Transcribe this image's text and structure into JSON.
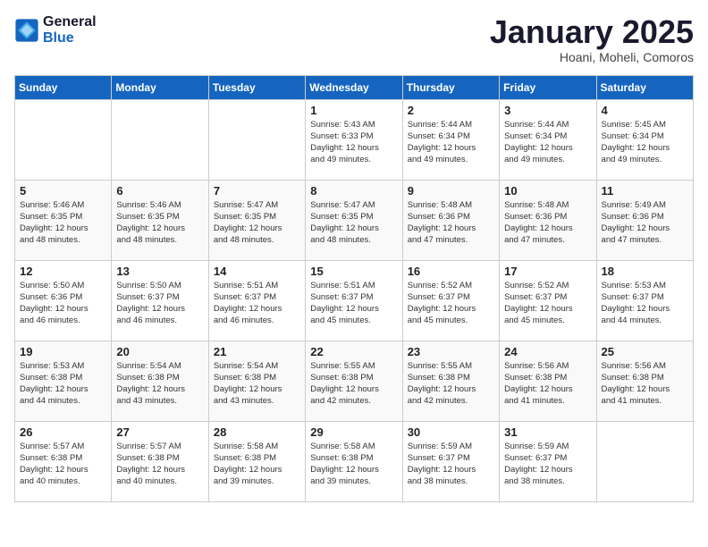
{
  "logo": {
    "line1": "General",
    "line2": "Blue"
  },
  "title": "January 2025",
  "subtitle": "Hoani, Moheli, Comoros",
  "weekdays": [
    "Sunday",
    "Monday",
    "Tuesday",
    "Wednesday",
    "Thursday",
    "Friday",
    "Saturday"
  ],
  "weeks": [
    [
      {
        "day": "",
        "info": ""
      },
      {
        "day": "",
        "info": ""
      },
      {
        "day": "",
        "info": ""
      },
      {
        "day": "1",
        "info": "Sunrise: 5:43 AM\nSunset: 6:33 PM\nDaylight: 12 hours\nand 49 minutes."
      },
      {
        "day": "2",
        "info": "Sunrise: 5:44 AM\nSunset: 6:34 PM\nDaylight: 12 hours\nand 49 minutes."
      },
      {
        "day": "3",
        "info": "Sunrise: 5:44 AM\nSunset: 6:34 PM\nDaylight: 12 hours\nand 49 minutes."
      },
      {
        "day": "4",
        "info": "Sunrise: 5:45 AM\nSunset: 6:34 PM\nDaylight: 12 hours\nand 49 minutes."
      }
    ],
    [
      {
        "day": "5",
        "info": "Sunrise: 5:46 AM\nSunset: 6:35 PM\nDaylight: 12 hours\nand 48 minutes."
      },
      {
        "day": "6",
        "info": "Sunrise: 5:46 AM\nSunset: 6:35 PM\nDaylight: 12 hours\nand 48 minutes."
      },
      {
        "day": "7",
        "info": "Sunrise: 5:47 AM\nSunset: 6:35 PM\nDaylight: 12 hours\nand 48 minutes."
      },
      {
        "day": "8",
        "info": "Sunrise: 5:47 AM\nSunset: 6:35 PM\nDaylight: 12 hours\nand 48 minutes."
      },
      {
        "day": "9",
        "info": "Sunrise: 5:48 AM\nSunset: 6:36 PM\nDaylight: 12 hours\nand 47 minutes."
      },
      {
        "day": "10",
        "info": "Sunrise: 5:48 AM\nSunset: 6:36 PM\nDaylight: 12 hours\nand 47 minutes."
      },
      {
        "day": "11",
        "info": "Sunrise: 5:49 AM\nSunset: 6:36 PM\nDaylight: 12 hours\nand 47 minutes."
      }
    ],
    [
      {
        "day": "12",
        "info": "Sunrise: 5:50 AM\nSunset: 6:36 PM\nDaylight: 12 hours\nand 46 minutes."
      },
      {
        "day": "13",
        "info": "Sunrise: 5:50 AM\nSunset: 6:37 PM\nDaylight: 12 hours\nand 46 minutes."
      },
      {
        "day": "14",
        "info": "Sunrise: 5:51 AM\nSunset: 6:37 PM\nDaylight: 12 hours\nand 46 minutes."
      },
      {
        "day": "15",
        "info": "Sunrise: 5:51 AM\nSunset: 6:37 PM\nDaylight: 12 hours\nand 45 minutes."
      },
      {
        "day": "16",
        "info": "Sunrise: 5:52 AM\nSunset: 6:37 PM\nDaylight: 12 hours\nand 45 minutes."
      },
      {
        "day": "17",
        "info": "Sunrise: 5:52 AM\nSunset: 6:37 PM\nDaylight: 12 hours\nand 45 minutes."
      },
      {
        "day": "18",
        "info": "Sunrise: 5:53 AM\nSunset: 6:37 PM\nDaylight: 12 hours\nand 44 minutes."
      }
    ],
    [
      {
        "day": "19",
        "info": "Sunrise: 5:53 AM\nSunset: 6:38 PM\nDaylight: 12 hours\nand 44 minutes."
      },
      {
        "day": "20",
        "info": "Sunrise: 5:54 AM\nSunset: 6:38 PM\nDaylight: 12 hours\nand 43 minutes."
      },
      {
        "day": "21",
        "info": "Sunrise: 5:54 AM\nSunset: 6:38 PM\nDaylight: 12 hours\nand 43 minutes."
      },
      {
        "day": "22",
        "info": "Sunrise: 5:55 AM\nSunset: 6:38 PM\nDaylight: 12 hours\nand 42 minutes."
      },
      {
        "day": "23",
        "info": "Sunrise: 5:55 AM\nSunset: 6:38 PM\nDaylight: 12 hours\nand 42 minutes."
      },
      {
        "day": "24",
        "info": "Sunrise: 5:56 AM\nSunset: 6:38 PM\nDaylight: 12 hours\nand 41 minutes."
      },
      {
        "day": "25",
        "info": "Sunrise: 5:56 AM\nSunset: 6:38 PM\nDaylight: 12 hours\nand 41 minutes."
      }
    ],
    [
      {
        "day": "26",
        "info": "Sunrise: 5:57 AM\nSunset: 6:38 PM\nDaylight: 12 hours\nand 40 minutes."
      },
      {
        "day": "27",
        "info": "Sunrise: 5:57 AM\nSunset: 6:38 PM\nDaylight: 12 hours\nand 40 minutes."
      },
      {
        "day": "28",
        "info": "Sunrise: 5:58 AM\nSunset: 6:38 PM\nDaylight: 12 hours\nand 39 minutes."
      },
      {
        "day": "29",
        "info": "Sunrise: 5:58 AM\nSunset: 6:38 PM\nDaylight: 12 hours\nand 39 minutes."
      },
      {
        "day": "30",
        "info": "Sunrise: 5:59 AM\nSunset: 6:37 PM\nDaylight: 12 hours\nand 38 minutes."
      },
      {
        "day": "31",
        "info": "Sunrise: 5:59 AM\nSunset: 6:37 PM\nDaylight: 12 hours\nand 38 minutes."
      },
      {
        "day": "",
        "info": ""
      }
    ]
  ]
}
